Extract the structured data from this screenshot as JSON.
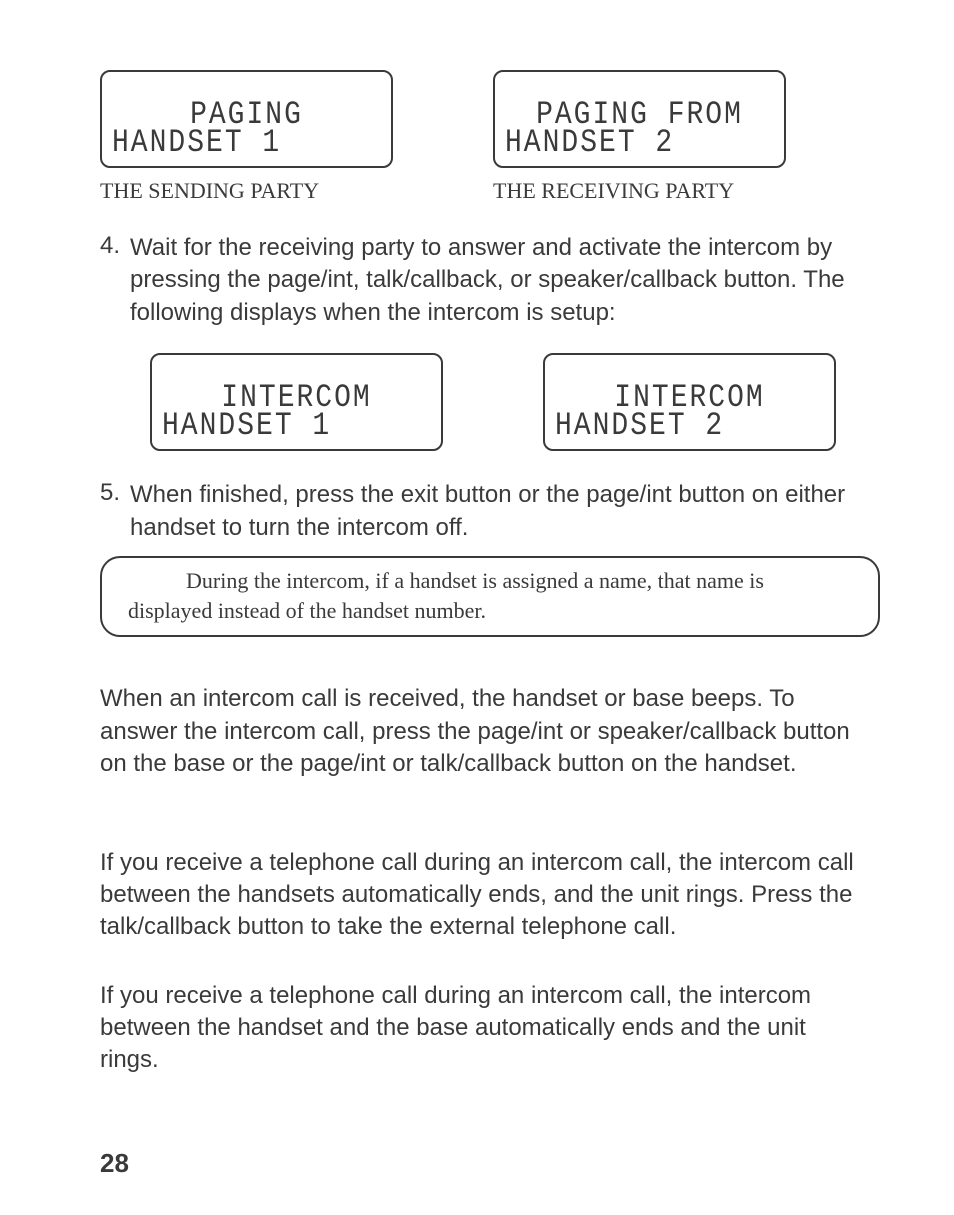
{
  "displays": {
    "row1": {
      "sender": {
        "line1": "PAGING",
        "line2": "HANDSET 1",
        "caption": "THE SENDING PARTY"
      },
      "receiver": {
        "line1": "PAGING FROM",
        "line2": "HANDSET 2",
        "caption": "THE RECEIVING PARTY"
      }
    },
    "row2": {
      "left": {
        "line1": "INTERCOM",
        "line2": "HANDSET 1"
      },
      "right": {
        "line1": "INTERCOM",
        "line2": "HANDSET 2"
      }
    }
  },
  "steps": {
    "s4": {
      "num": "4.",
      "text": "Wait for the receiving party to answer and activate the intercom by pressing the page/int, talk/callback, or speaker/callback button. The following displays when the intercom is setup:"
    },
    "s5": {
      "num": "5.",
      "text": "When finished, press the exit button or the page/int button on either handset to turn the intercom off."
    }
  },
  "note": "During the intercom, if a handset is assigned a name, that name is displayed instead of the handset number.",
  "paragraphs": {
    "p1": "When an intercom call is received, the handset or base beeps. To answer the intercom call, press the page/int or speaker/callback button on the base or the page/int or talk/callback button on the handset.",
    "p2": "If you receive a telephone call during an intercom call, the intercom call between the handsets automatically ends, and the unit rings. Press the talk/callback button to take the external telephone call.",
    "p3": "If you receive a telephone call during an intercom call, the intercom between the handset and the base automatically ends and the unit rings."
  },
  "page_number": "28"
}
